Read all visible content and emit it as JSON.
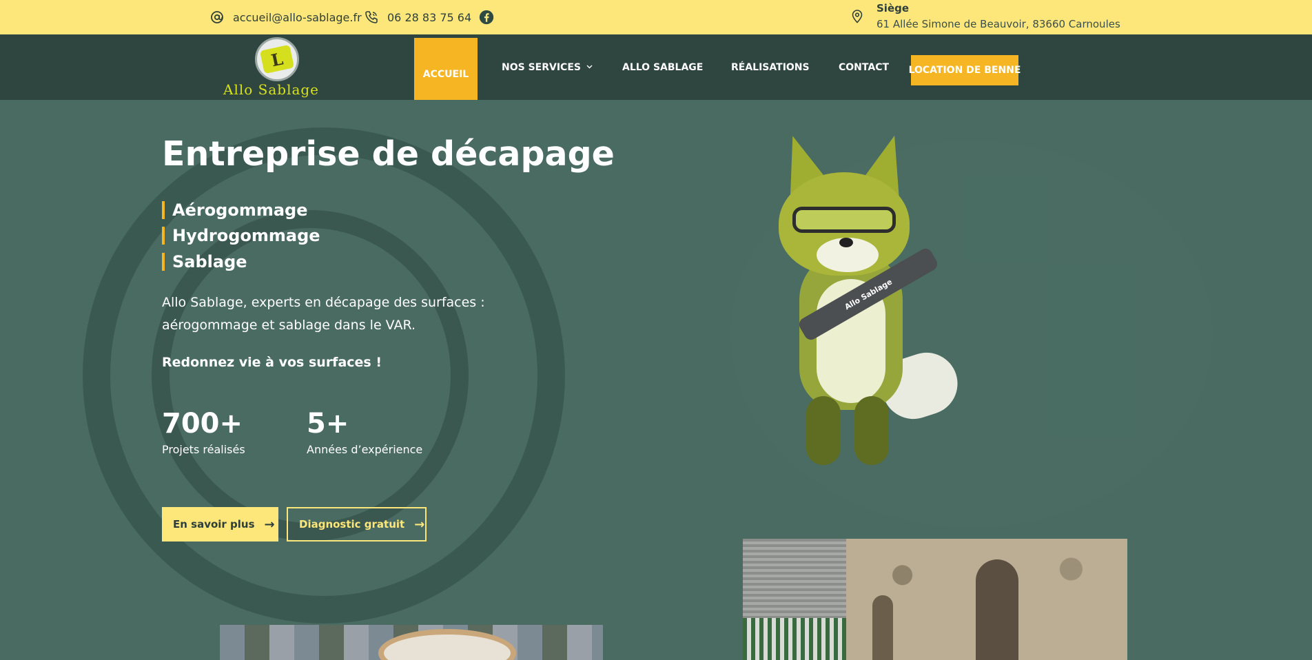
{
  "topbar": {
    "email": "accueil@allo-sablage.fr",
    "phone": "06 28 83 75 64",
    "siege_title": "Siège",
    "siege_address": "61 Allée Simone de Beauvoir, 83660 Carnoules",
    "icons": {
      "email": "at-icon",
      "phone": "phone-icon",
      "social": "facebook-icon",
      "address": "map-pin-icon"
    }
  },
  "nav": {
    "logo_text": "Allo Sablage",
    "items": [
      {
        "label": "ACCUEIL",
        "active": true
      },
      {
        "label": "NOS SERVICES"
      },
      {
        "label": "ALLO SABLAGE"
      },
      {
        "label": "RÉALISATIONS"
      },
      {
        "label": "CONTACT"
      }
    ],
    "cta": "LOCATION DE BENNE"
  },
  "hero": {
    "title": "Entreprise de décapage",
    "services": [
      "Aérogommage",
      "Hydrogommage",
      "Sablage"
    ],
    "description": "Allo Sablage, experts en décapage des surfaces : aérogommage et sablage dans le VAR.",
    "tagline": "Redonnez vie à vos surfaces !",
    "stats": [
      {
        "value": "700+",
        "label": "Projets réalisés"
      },
      {
        "value": "5+",
        "label": "Années d’expérience"
      }
    ],
    "buttons": {
      "primary": "En savoir plus",
      "secondary": "Diagnostic gratuit"
    },
    "mascot_gun_text": "Allo Sablage"
  },
  "colors": {
    "topbar": "#fde77b",
    "nav": "#2f4640",
    "accent": "#f6b623",
    "hero": "#4a6b62"
  }
}
